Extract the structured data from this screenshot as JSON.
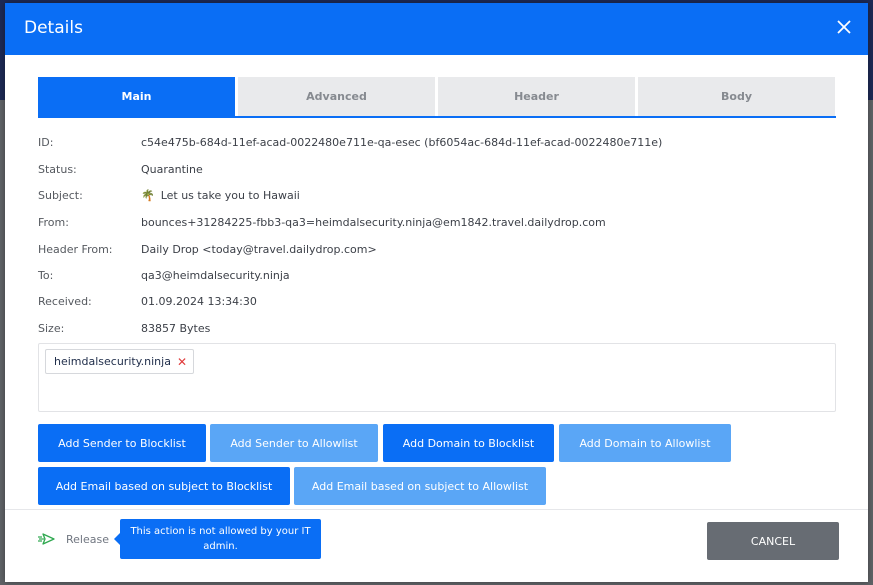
{
  "modal": {
    "title": "Details",
    "close_icon": "close-icon"
  },
  "tabs": [
    {
      "label": "Main",
      "active": true
    },
    {
      "label": "Advanced",
      "active": false
    },
    {
      "label": "Header",
      "active": false
    },
    {
      "label": "Body",
      "active": false
    }
  ],
  "details": {
    "id": {
      "label": "ID:",
      "value": "c54e475b-684d-11ef-acad-0022480e711e-qa-esec (bf6054ac-684d-11ef-acad-0022480e711e)"
    },
    "status": {
      "label": "Status:",
      "value": "Quarantine"
    },
    "subject": {
      "label": "Subject:",
      "emoji": "🌴",
      "value": "Let us take you to Hawaii"
    },
    "from": {
      "label": "From:",
      "value": "bounces+31284225-fbb3-qa3=heimdalsecurity.ninja@em1842.travel.dailydrop.com"
    },
    "header_from": {
      "label": "Header From:",
      "value": "Daily Drop <today@travel.dailydrop.com>"
    },
    "to": {
      "label": "To:",
      "value": "qa3@heimdalsecurity.ninja"
    },
    "received": {
      "label": "Received:",
      "value": "01.09.2024 13:34:30"
    },
    "size": {
      "label": "Size:",
      "value": "83857 Bytes"
    }
  },
  "tags": [
    {
      "label": "heimdalsecurity.ninja",
      "remove_icon": "close-icon"
    }
  ],
  "actions": {
    "add_sender_blocklist": "Add Sender to Blocklist",
    "add_sender_allowlist": "Add Sender to Allowlist",
    "add_domain_blocklist": "Add Domain to Blocklist",
    "add_domain_allowlist": "Add Domain to Allowlist",
    "add_email_subject_blocklist": "Add Email based on subject to Blocklist",
    "add_email_subject_allowlist": "Add Email based on subject to Allowlist"
  },
  "footer": {
    "release_label": "Release",
    "release_icon": "send-icon",
    "tooltip": "This action is not allowed by your IT admin.",
    "cancel_label": "CANCEL"
  },
  "colors": {
    "primary": "#0a6ef5",
    "primary_light": "#5aa6f6",
    "cancel": "#676c73",
    "remove": "#e03b3b"
  }
}
